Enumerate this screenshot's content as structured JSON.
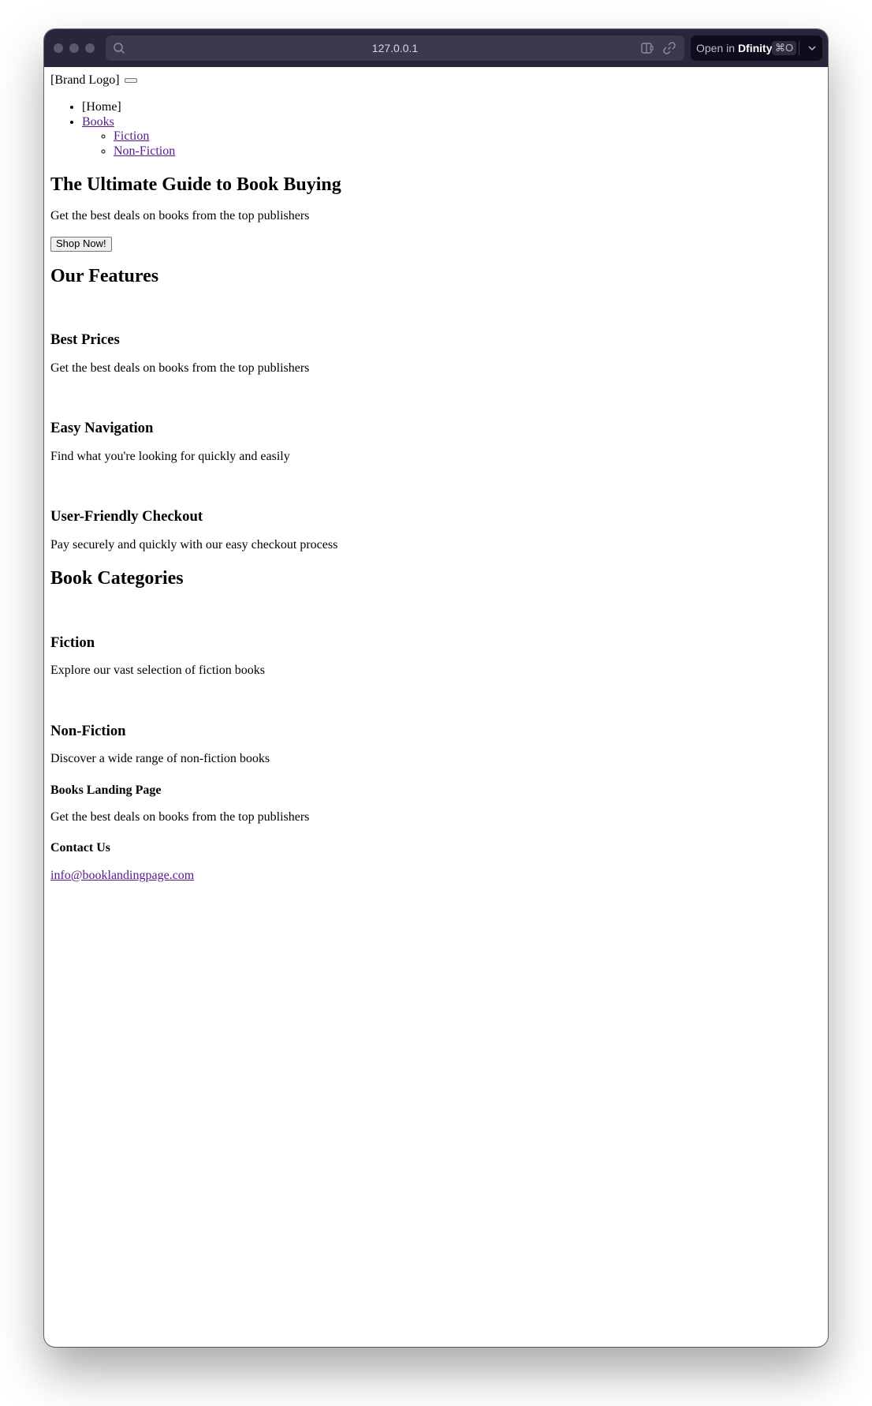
{
  "browser": {
    "url": "127.0.0.1",
    "open_in_prefix": "Open in",
    "open_in_app": "Dfinity",
    "open_in_shortcut": "⌘O"
  },
  "header": {
    "brand_logo": "[Brand Logo]"
  },
  "nav": {
    "home": "[Home]",
    "books": "Books",
    "sub": [
      "Fiction",
      "Non-Fiction"
    ]
  },
  "hero": {
    "title": "The Ultimate Guide to Book Buying",
    "subtitle": "Get the best deals on books from the top publishers",
    "cta": "Shop Now!"
  },
  "features": {
    "heading": "Our Features",
    "items": [
      {
        "title": "Best Prices",
        "text": "Get the best deals on books from the top publishers"
      },
      {
        "title": "Easy Navigation",
        "text": "Find what you're looking for quickly and easily"
      },
      {
        "title": "User-Friendly Checkout",
        "text": "Pay securely and quickly with our easy checkout process"
      }
    ]
  },
  "categories": {
    "heading": "Book Categories",
    "items": [
      {
        "title": "Fiction",
        "text": "Explore our vast selection of fiction books"
      },
      {
        "title": "Non-Fiction",
        "text": "Discover a wide range of non-fiction books"
      }
    ]
  },
  "footer": {
    "about_title": "Books Landing Page",
    "about_text": "Get the best deals on books from the top publishers",
    "contact_title": "Contact Us",
    "email": "info@booklandingpage.com"
  }
}
